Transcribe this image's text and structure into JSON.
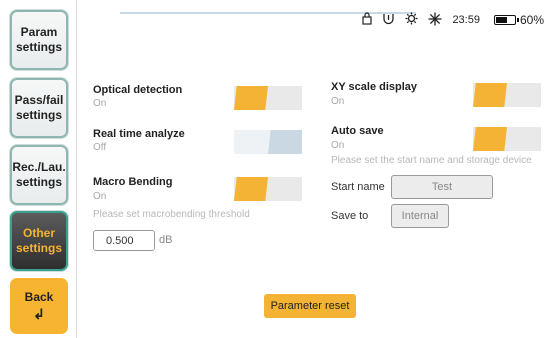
{
  "sidebar": {
    "items": [
      {
        "label": "Param settings"
      },
      {
        "label": "Pass/fail settings"
      },
      {
        "label": "Rec./Lau. settings"
      },
      {
        "label": "Other settings"
      },
      {
        "label": "Back"
      }
    ],
    "back_icon": "↲"
  },
  "status": {
    "icons": [
      "lock-icon",
      "usb-icon",
      "settings-icon",
      "laser-icon"
    ],
    "time": "23:59",
    "battery_level": 0.6,
    "battery_pct": "60%"
  },
  "settings": {
    "optical_detection": {
      "label": "Optical detection",
      "state": "On"
    },
    "realtime_analyze": {
      "label": "Real time analyze",
      "state": "Off"
    },
    "macro_bending": {
      "label": "Macro Bending",
      "state": "On",
      "hint": "Please set macrobending threshold",
      "value": "0.500",
      "unit": "dB"
    },
    "xy_scale": {
      "label": "XY scale display",
      "state": "On"
    },
    "auto_save": {
      "label": "Auto save",
      "state": "On",
      "hint": "Please set the start name and storage device"
    },
    "start_name": {
      "label": "Start name",
      "value": "Test"
    },
    "save_to": {
      "label": "Save to",
      "value": "Internal"
    }
  },
  "reset_label": "Parameter reset",
  "colors": {
    "accent": "#f5b335",
    "active_bg": "#3a3a3a",
    "border_teal": "#3aa090"
  }
}
